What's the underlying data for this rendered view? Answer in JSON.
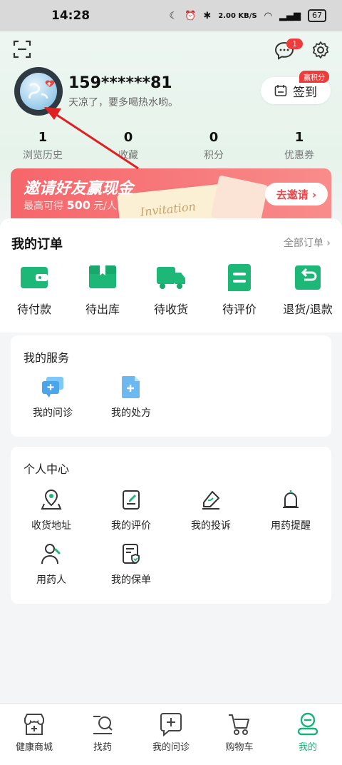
{
  "status_bar": {
    "time": "14:28",
    "speed": "2.00 KB/S",
    "battery": "67"
  },
  "header": {
    "msg_badge": "1"
  },
  "profile": {
    "username": "159******81",
    "motto": "天凉了，要多喝热水哟。",
    "checkin_label": "签到",
    "checkin_badge": "赢积分"
  },
  "stats": [
    {
      "value": "1",
      "label": "浏览历史"
    },
    {
      "value": "0",
      "label": "收藏"
    },
    {
      "value": "0",
      "label": "积分"
    },
    {
      "value": "1",
      "label": "优惠券"
    }
  ],
  "banner": {
    "title": "邀请好友赢现金",
    "sub_prefix": "最高可得",
    "sub_amount": "500",
    "sub_suffix": "元/人",
    "ticket_text": "Invitation",
    "button": "去邀请 ›"
  },
  "orders": {
    "title": "我的订单",
    "all_label": "全部订单 ›",
    "items": [
      {
        "label": "待付款",
        "icon": "wallet-icon"
      },
      {
        "label": "待出库",
        "icon": "package-icon"
      },
      {
        "label": "待收货",
        "icon": "truck-icon"
      },
      {
        "label": "待评价",
        "icon": "review-icon"
      },
      {
        "label": "退货/退款",
        "icon": "refund-icon"
      }
    ]
  },
  "services": {
    "title": "我的服务",
    "items": [
      {
        "label": "我的问诊",
        "icon": "consult-icon"
      },
      {
        "label": "我的处方",
        "icon": "prescription-icon"
      }
    ]
  },
  "personal": {
    "title": "个人中心",
    "items": [
      {
        "label": "收货地址",
        "icon": "location-icon"
      },
      {
        "label": "我的评价",
        "icon": "edit-icon"
      },
      {
        "label": "我的投诉",
        "icon": "complaint-icon"
      },
      {
        "label": "用药提醒",
        "icon": "bell-icon"
      },
      {
        "label": "用药人",
        "icon": "person-icon"
      },
      {
        "label": "我的保单",
        "icon": "policy-icon"
      }
    ]
  },
  "tabbar": [
    {
      "label": "健康商城",
      "icon": "store-icon"
    },
    {
      "label": "找药",
      "icon": "search-drug-icon"
    },
    {
      "label": "我的问诊",
      "icon": "chat-plus-icon"
    },
    {
      "label": "购物车",
      "icon": "cart-icon"
    },
    {
      "label": "我的",
      "icon": "profile-icon",
      "active": true
    }
  ],
  "colors": {
    "accent": "#17b37a",
    "banner": "#f6666b",
    "badge": "#ee3b3b"
  }
}
